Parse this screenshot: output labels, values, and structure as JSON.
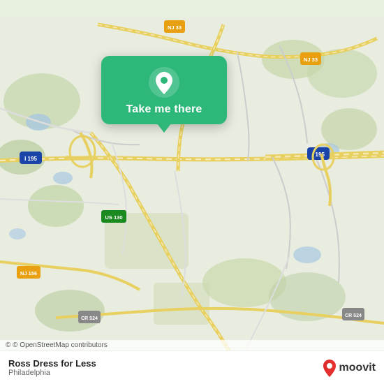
{
  "map": {
    "attribution": "© OpenStreetMap contributors",
    "background_color": "#e8f0e0"
  },
  "popup": {
    "button_label": "Take me there",
    "background_color": "#2db87a",
    "icon": "location-pin-icon"
  },
  "info_bar": {
    "store_name": "Ross Dress for Less",
    "store_city": "Philadelphia",
    "logo_text": "moovit"
  },
  "road_labels": {
    "nj33_top": "NJ 33",
    "nj33_right": "NJ 33",
    "i195_left": "I 195",
    "i195_right": "I 195",
    "us130": "US 130",
    "nj156": "NJ 156",
    "cr524_left": "CR 524",
    "cr524_right": "CR 524"
  }
}
